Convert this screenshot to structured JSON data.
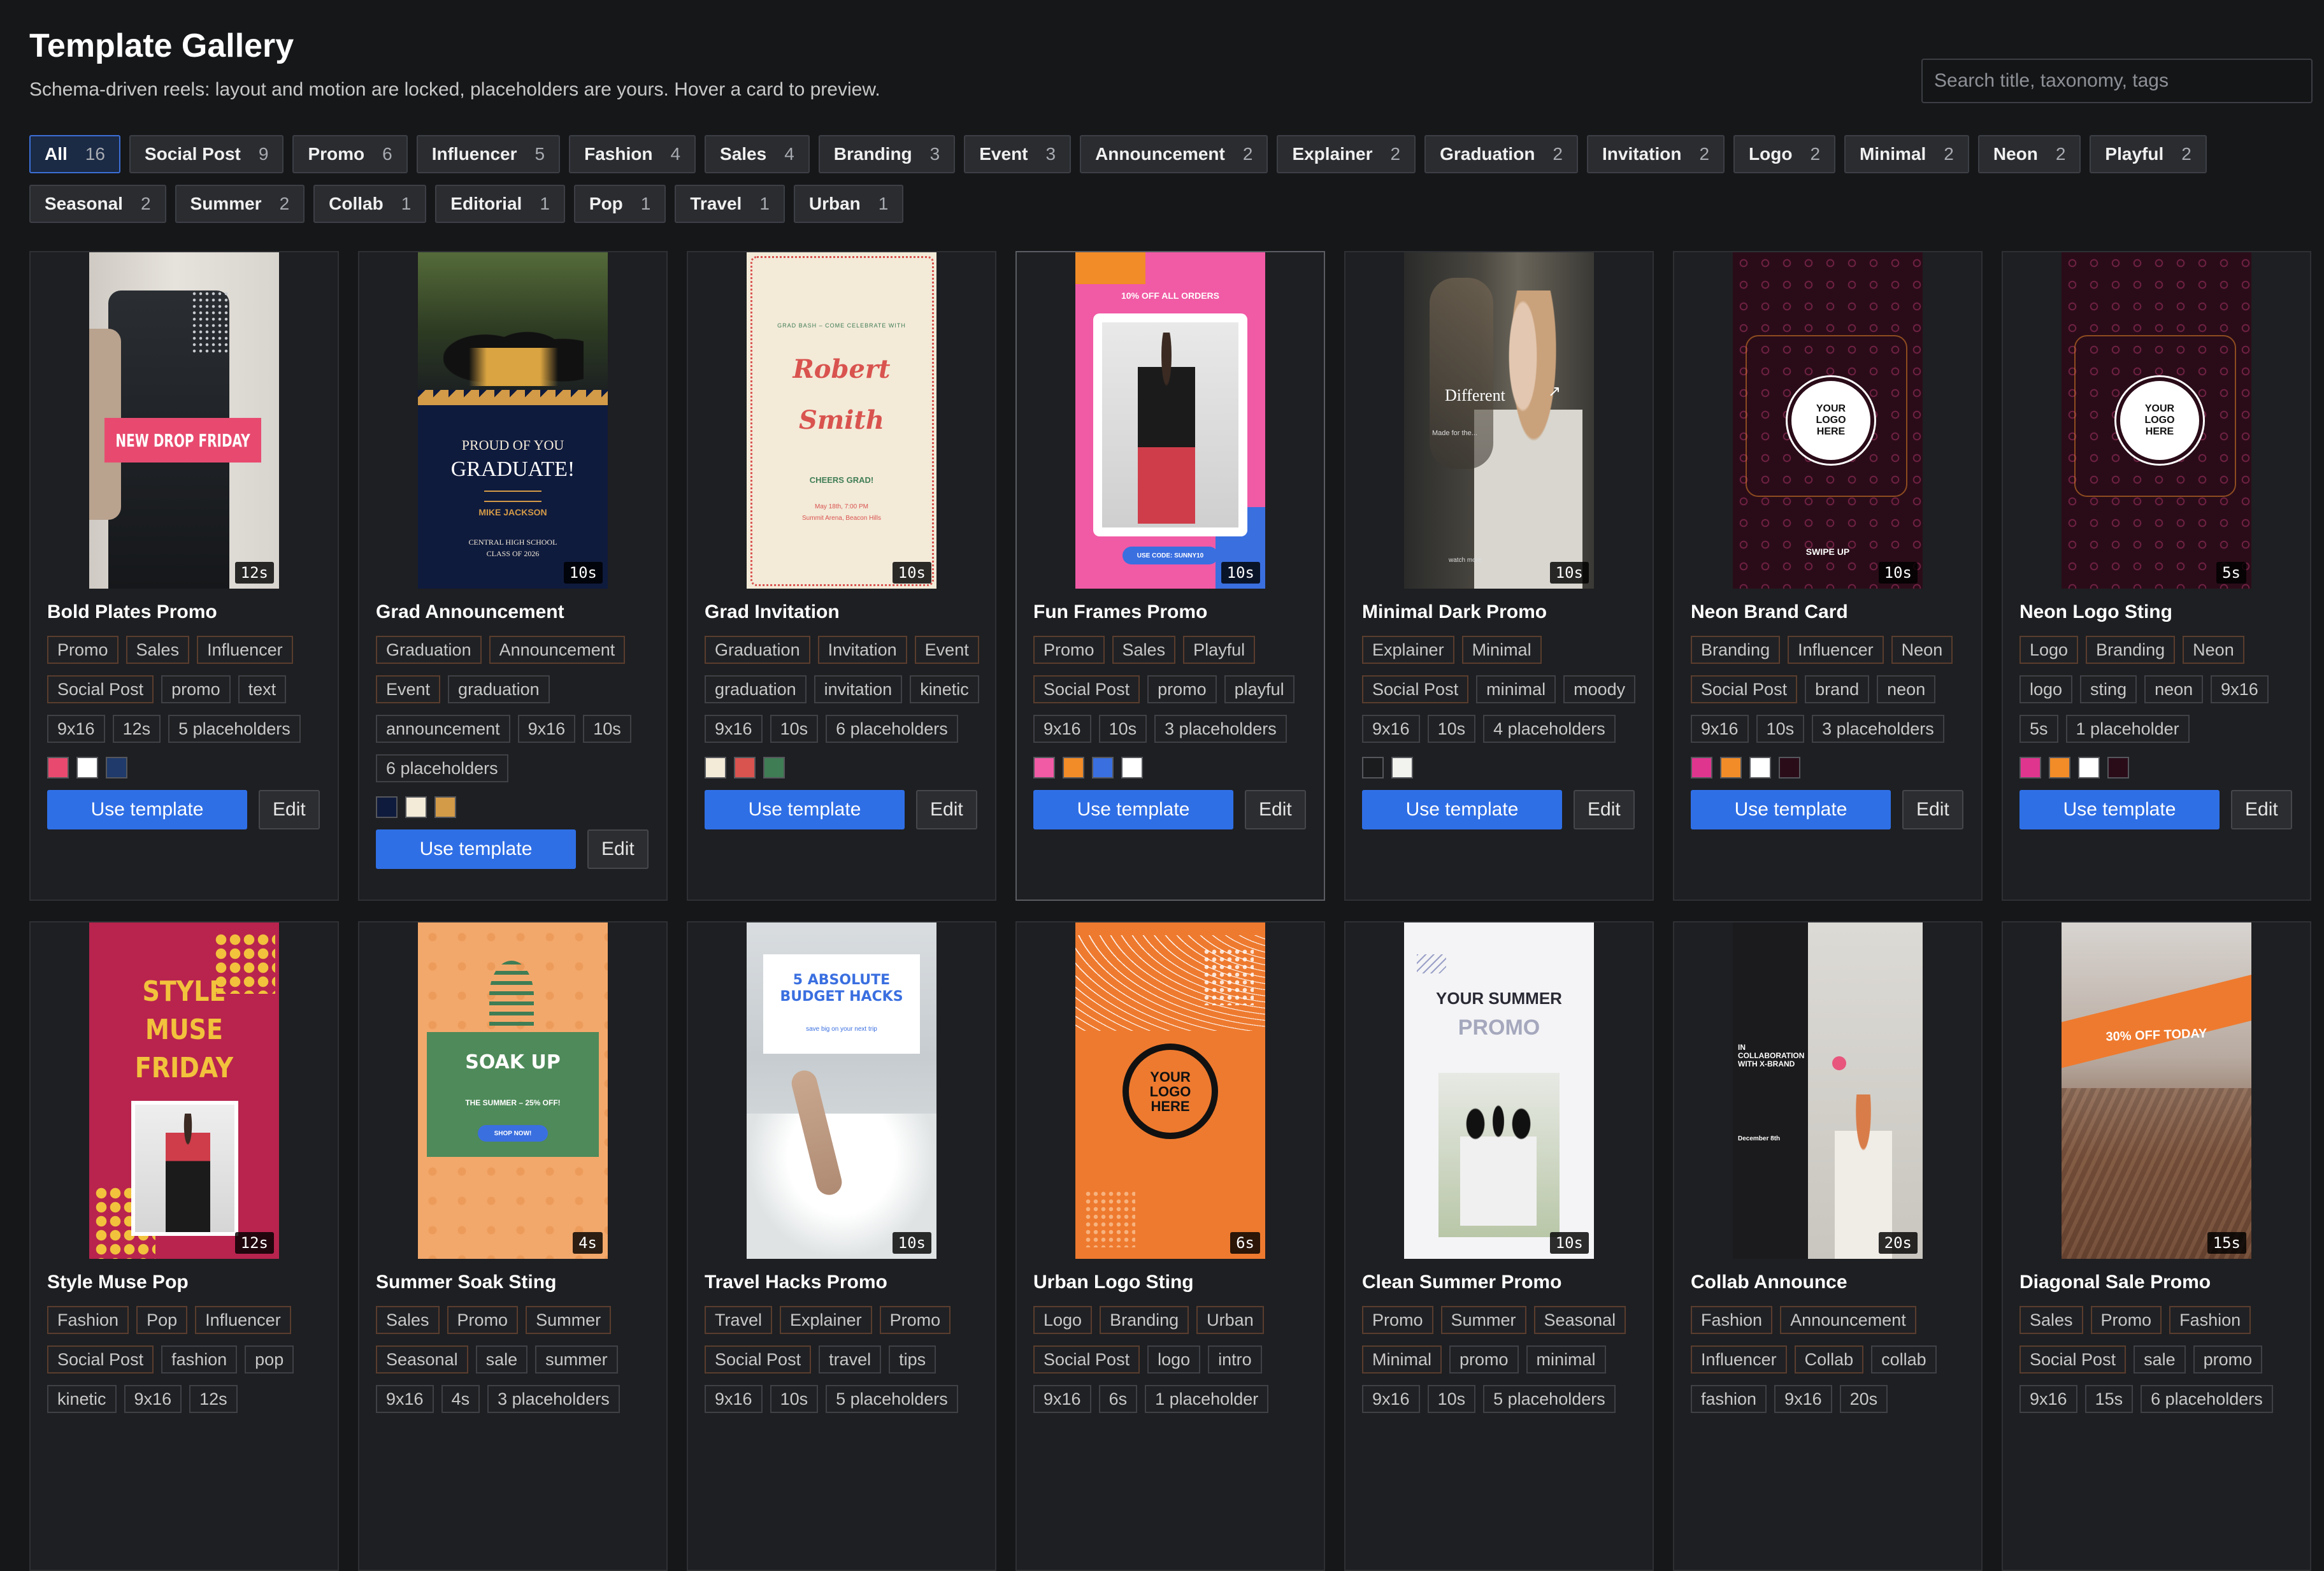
{
  "header": {
    "title": "Template Gallery",
    "subtitle": "Schema-driven reels: layout and motion are locked, placeholders are yours. Hover a card to preview."
  },
  "search": {
    "placeholder": "Search title, taxonomy, tags",
    "value": ""
  },
  "filters": [
    {
      "label": "All",
      "count": "16",
      "active": true
    },
    {
      "label": "Social Post",
      "count": "9"
    },
    {
      "label": "Promo",
      "count": "6"
    },
    {
      "label": "Influencer",
      "count": "5"
    },
    {
      "label": "Fashion",
      "count": "4"
    },
    {
      "label": "Sales",
      "count": "4"
    },
    {
      "label": "Branding",
      "count": "3"
    },
    {
      "label": "Event",
      "count": "3"
    },
    {
      "label": "Announcement",
      "count": "2"
    },
    {
      "label": "Explainer",
      "count": "2"
    },
    {
      "label": "Graduation",
      "count": "2"
    },
    {
      "label": "Invitation",
      "count": "2"
    },
    {
      "label": "Logo",
      "count": "2"
    },
    {
      "label": "Minimal",
      "count": "2"
    },
    {
      "label": "Neon",
      "count": "2"
    },
    {
      "label": "Playful",
      "count": "2"
    },
    {
      "label": "Seasonal",
      "count": "2"
    },
    {
      "label": "Summer",
      "count": "2"
    },
    {
      "label": "Collab",
      "count": "1"
    },
    {
      "label": "Editorial",
      "count": "1"
    },
    {
      "label": "Pop",
      "count": "1"
    },
    {
      "label": "Travel",
      "count": "1"
    },
    {
      "label": "Urban",
      "count": "1"
    }
  ],
  "actions": {
    "use_label": "Use template",
    "edit_label": "Edit"
  },
  "cards": [
    {
      "name": "Bold Plates Promo",
      "duration": "12s",
      "thumb": "bold",
      "tags": [
        "Promo",
        "Sales",
        "Influencer",
        "Social Post",
        "promo",
        "text",
        "9x16",
        "12s",
        "5 placeholders"
      ],
      "swatches": [
        "#e84a6f",
        "#ffffff",
        "#1f3a6b"
      ],
      "thumb_text": {
        "banner": "NEW DROP FRIDAY"
      }
    },
    {
      "name": "Grad Announcement",
      "duration": "10s",
      "thumb": "grad",
      "tags": [
        "Graduation",
        "Announcement",
        "Event",
        "graduation",
        "announcement",
        "9x16",
        "10s",
        "6 placeholders"
      ],
      "swatches": [
        "#0f1b3d",
        "#f3ead8",
        "#d39a48"
      ],
      "thumb_text": {
        "l1": "PROUD OF YOU",
        "l2": "GRADUATE!",
        "l3": "MIKE JACKSON",
        "l4": "CENTRAL HIGH SCHOOL",
        "l5": "CLASS OF 2026"
      }
    },
    {
      "name": "Grad Invitation",
      "duration": "10s",
      "thumb": "invite",
      "tags": [
        "Graduation",
        "Invitation",
        "Event",
        "graduation",
        "invitation",
        "kinetic",
        "9x16",
        "10s",
        "6 placeholders"
      ],
      "swatches": [
        "#f3ead8",
        "#d9534f",
        "#3f7d55"
      ],
      "thumb_text": {
        "l1": "GRAD BASH – COME CELEBRATE WITH",
        "l2": "Robert",
        "l3": "Smith",
        "l4": "CHEERS GRAD!",
        "l5": "May 18th, 7:00 PM",
        "l6": "Summit Arena, Beacon Hills"
      }
    },
    {
      "name": "Fun Frames Promo",
      "duration": "10s",
      "thumb": "frames",
      "highlight": true,
      "tags": [
        "Promo",
        "Sales",
        "Playful",
        "Social Post",
        "promo",
        "playful",
        "9x16",
        "10s",
        "3 placeholders"
      ],
      "swatches": [
        "#f15aa5",
        "#f28c28",
        "#3a6fe0",
        "#ffffff"
      ],
      "thumb_text": {
        "top": "10% OFF ALL ORDERS",
        "code": "USE CODE: SUNNY10"
      }
    },
    {
      "name": "Minimal Dark Promo",
      "duration": "10s",
      "thumb": "minimal",
      "tags": [
        "Explainer",
        "Minimal",
        "Social Post",
        "minimal",
        "moody",
        "9x16",
        "10s",
        "4 placeholders"
      ],
      "swatches": [
        "#1a1c1e",
        "#f2f2ee"
      ],
      "thumb_text": {
        "l1": "Different",
        "l2": "Made for the...",
        "l3": "watch more"
      }
    },
    {
      "name": "Neon Brand Card",
      "duration": "10s",
      "thumb": "neon",
      "tags": [
        "Branding",
        "Influencer",
        "Neon",
        "Social Post",
        "brand",
        "neon",
        "9x16",
        "10s",
        "3 placeholders"
      ],
      "swatches": [
        "#e0358f",
        "#f28c28",
        "#ffffff",
        "#2a0c18"
      ],
      "thumb_text": {
        "logo": "YOUR LOGO HERE",
        "swipe": "SWIPE UP"
      }
    },
    {
      "name": "Neon Logo Sting",
      "duration": "5s",
      "thumb": "neon",
      "tags": [
        "Logo",
        "Branding",
        "Neon",
        "logo",
        "sting",
        "neon",
        "9x16",
        "5s",
        "1 placeholder"
      ],
      "swatches": [
        "#e0358f",
        "#f28c28",
        "#ffffff",
        "#2a0c18"
      ],
      "thumb_text": {
        "logo": "YOUR LOGO HERE",
        "swipe": ""
      }
    },
    {
      "name": "Style Muse Pop",
      "duration": "12s",
      "thumb": "muse",
      "tags": [
        "Fashion",
        "Pop",
        "Influencer",
        "Social Post",
        "fashion",
        "pop",
        "kinetic",
        "9x16",
        "12s"
      ],
      "swatches": [],
      "thumb_text": {
        "l1": "STYLE",
        "l2": "MUSE",
        "l3": "FRIDAY"
      }
    },
    {
      "name": "Summer Soak Sting",
      "duration": "4s",
      "thumb": "soak",
      "tags": [
        "Sales",
        "Promo",
        "Summer",
        "Seasonal",
        "sale",
        "summer",
        "9x16",
        "4s",
        "3 placeholders"
      ],
      "swatches": [],
      "thumb_text": {
        "l1": "SOAK UP",
        "l2": "THE SUMMER – 25% OFF!",
        "l3": "SHOP NOW!"
      }
    },
    {
      "name": "Travel Hacks Promo",
      "duration": "10s",
      "thumb": "travel",
      "tags": [
        "Travel",
        "Explainer",
        "Promo",
        "Social Post",
        "travel",
        "tips",
        "9x16",
        "10s",
        "5 placeholders"
      ],
      "swatches": [],
      "thumb_text": {
        "l1": "5 ABSOLUTE BUDGET HACKS",
        "l2": "save big on your next trip"
      }
    },
    {
      "name": "Urban Logo Sting",
      "duration": "6s",
      "thumb": "urban",
      "tags": [
        "Logo",
        "Branding",
        "Urban",
        "Social Post",
        "logo",
        "intro",
        "9x16",
        "6s",
        "1 placeholder"
      ],
      "swatches": [],
      "thumb_text": {
        "logo": "YOUR LOGO HERE"
      }
    },
    {
      "name": "Clean Summer Promo",
      "duration": "10s",
      "thumb": "clean",
      "tags": [
        "Promo",
        "Summer",
        "Seasonal",
        "Minimal",
        "promo",
        "minimal",
        "9x16",
        "10s",
        "5 placeholders"
      ],
      "swatches": [],
      "thumb_text": {
        "l1": "YOUR SUMMER",
        "l2": "PROMO"
      }
    },
    {
      "name": "Collab Announce",
      "duration": "20s",
      "thumb": "collab",
      "tags": [
        "Fashion",
        "Announcement",
        "Influencer",
        "Collab",
        "collab",
        "fashion",
        "9x16",
        "20s"
      ],
      "swatches": [],
      "thumb_text": {
        "l1": "IN COLLABORATION WITH X-BRAND",
        "l2": "December 8th"
      }
    },
    {
      "name": "Diagonal Sale Promo",
      "duration": "15s",
      "thumb": "diagonal",
      "tags": [
        "Sales",
        "Promo",
        "Fashion",
        "Social Post",
        "sale",
        "promo",
        "9x16",
        "15s",
        "6 placeholders"
      ],
      "swatches": [],
      "thumb_text": {
        "l1": "30% OFF TODAY"
      }
    }
  ]
}
